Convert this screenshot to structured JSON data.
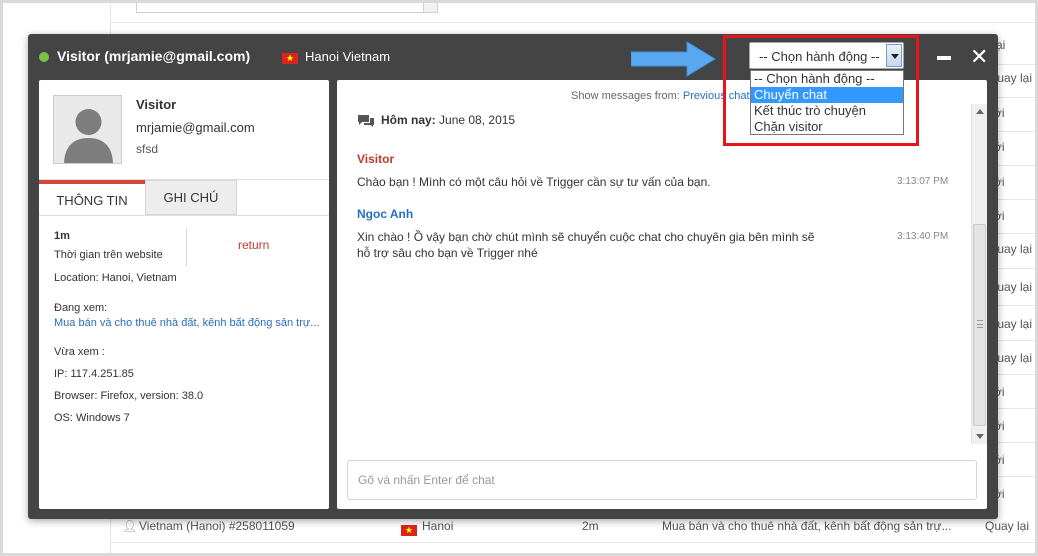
{
  "background": {
    "right_column": [
      "ại",
      "Quay lại",
      "ởi",
      "ởi",
      "ởi",
      "ởi",
      "Quay lại",
      "Quay lại",
      "Quay lại",
      "Quay lại",
      "ởi",
      "ởi",
      "ởi",
      "ởi"
    ],
    "bottom_row": {
      "visitor": "Vietnam (Hanoi) #258011059",
      "city": "Hanoi",
      "duration": "2m",
      "page": "Mua bán và cho thuê nhà đất, kênh bất động sản trự...",
      "status": "Quay lại"
    }
  },
  "header": {
    "title": "Visitor (mrjamie@gmail.com)",
    "location": "Hanoi Vietnam",
    "status_color": "#7cc242"
  },
  "action_select": {
    "current": "-- Chọn hành động --",
    "options": [
      "-- Chọn hành động --",
      "Chuyển chat",
      "Kết thúc trò chuyện",
      "Chặn visitor"
    ],
    "highlighted": "Chuyển chat"
  },
  "profile": {
    "name": "Visitor",
    "email": "mrjamie@gmail.com",
    "note": "sfsd"
  },
  "tabs": {
    "info": "THÔNG TIN",
    "notes": "GHI CHÚ"
  },
  "info": {
    "time_value": "1m",
    "time_label": "Thời gian trên website",
    "return_label": "return",
    "location": "Location: Hanoi, Vietnam",
    "viewing_label": "Đang xem:",
    "viewing_link": "Mua bán và cho thuê nhà đất, kênh bất động sản trự...",
    "recent_label": "Vừa xem :",
    "ip": "IP: 117.4.251.85",
    "browser": "Browser: Firefox, version: 38.0",
    "os": "OS: Windows 7"
  },
  "chat": {
    "show_messages_label": "Show messages from:",
    "show_messages_link": "Previous chat",
    "date_prefix": "Hôm nay:",
    "date_value": "June 08, 2015",
    "messages": [
      {
        "sender": "Visitor",
        "text": "Chào bạn ! Mình có một câu hỏi về Trigger cần sự tư vấn của bạn.",
        "time": "3:13:07 PM",
        "color": "#c0392b"
      },
      {
        "sender": "Ngoc Anh",
        "text": "Xin chào ! Ồ vậy bạn chờ chút mình sẽ chuyển cuộc chat cho chuyên gia bên mình sẽ hỗ trợ sâu cho bạn về Trigger nhé",
        "time": "3:13:40 PM",
        "color": "#2a6ebb"
      }
    ],
    "input_placeholder": "Gõ và nhấn Enter để chat"
  },
  "colors": {
    "popup_bg": "#444444",
    "tab_accent": "#d0473c",
    "highlight_border": "#e8141b",
    "arrow": "#5aa9f0",
    "selected_option": "#3399ff"
  }
}
